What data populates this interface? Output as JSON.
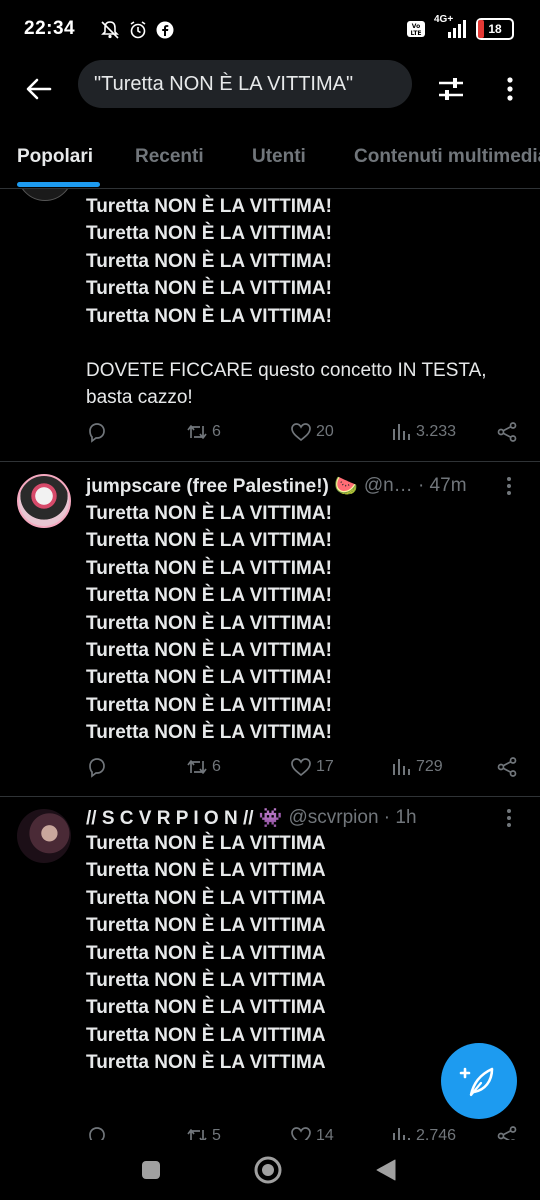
{
  "status_bar": {
    "time": "22:34",
    "network": "4G+",
    "volte": "Vo LTE",
    "battery_level": "18",
    "battery_color": "#e53935"
  },
  "header": {
    "back_icon": "arrow-left-icon",
    "search_query": "\"Turetta NON È LA VITTIMA\"",
    "filter_icon": "sliders-icon",
    "more_icon": "more-vertical-icon"
  },
  "tabs": [
    {
      "label": "Popolari",
      "active": true
    },
    {
      "label": "Recenti",
      "active": false
    },
    {
      "label": "Utenti",
      "active": false
    },
    {
      "label": "Contenuti multimediali",
      "active": false
    }
  ],
  "tweets": [
    {
      "lines": [
        "Turetta NON È LA VITTIMA!",
        "Turetta NON È LA VITTIMA!",
        "Turetta NON È LA VITTIMA!",
        "Turetta NON È LA VITTIMA!",
        "Turetta NON È LA VITTIMA!"
      ],
      "text": "DOVETE FICCARE questo concetto IN TESTA, basta cazzo!",
      "stats": {
        "replies": "",
        "retweets": "6",
        "likes": "20",
        "views": "3.233"
      }
    },
    {
      "name": "jumpscare (free Palestine!) 🍉",
      "handle": "@n…",
      "time": "· 47m",
      "lines": [
        "Turetta NON È LA VITTIMA!",
        "Turetta NON È LA VITTIMA!",
        "Turetta NON È LA VITTIMA!",
        "Turetta NON È LA VITTIMA!",
        "Turetta NON È LA VITTIMA!",
        "Turetta NON È LA VITTIMA!",
        "Turetta NON È LA VITTIMA!",
        "Turetta NON È LA VITTIMA!",
        "Turetta NON È LA VITTIMA!"
      ],
      "stats": {
        "replies": "",
        "retweets": "6",
        "likes": "17",
        "views": "729"
      }
    },
    {
      "name": "// S C V R P I O N // 👾",
      "handle": "@scvrpion",
      "time": "· 1h",
      "lines": [
        "Turetta NON È LA VITTIMA",
        "Turetta NON È LA VITTIMA",
        "Turetta NON È LA VITTIMA",
        "Turetta NON È LA VITTIMA",
        "Turetta NON È LA VITTIMA",
        "Turetta NON È LA VITTIMA",
        "Turetta NON È LA VITTIMA",
        "Turetta NON È LA VITTIMA",
        "Turetta NON È LA VITTIMA"
      ],
      "stats": {
        "replies": "",
        "retweets": "5",
        "likes": "14",
        "views": "2.746"
      }
    }
  ],
  "fab": {
    "icon": "compose-feather-icon",
    "color": "#1d9bf0"
  },
  "accent_color": "#1d9bf0"
}
